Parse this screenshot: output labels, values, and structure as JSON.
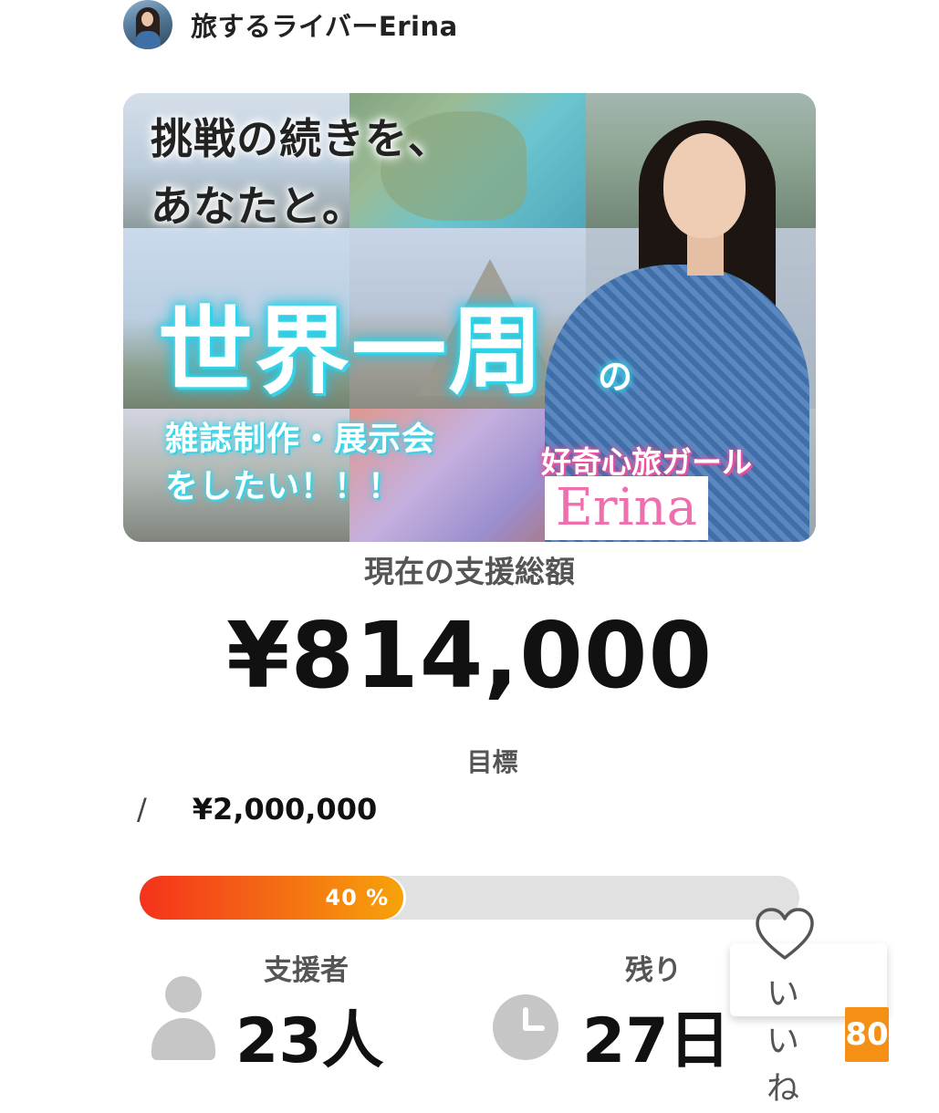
{
  "author": {
    "name": "旅するライバーErina"
  },
  "hero": {
    "line1": "挑戦の続きを、",
    "line2": "あなたと。",
    "big": "世界一周",
    "no": "の",
    "sub1": "雑誌制作・展示会",
    "sub2": "をしたい！！！",
    "tagline": "好奇心旅ガール",
    "name": "Erina"
  },
  "funding": {
    "total_label": "現在の支援総額",
    "total_amount": "¥814,000",
    "goal_label": "目標",
    "goal_slash": "/",
    "goal_amount": "¥2,000,000",
    "progress_percent": 40,
    "progress_label": "40 %"
  },
  "stats": {
    "backers_label": "支援者",
    "backers_value": "23人",
    "remaining_label": "残り",
    "remaining_value": "27日"
  },
  "like": {
    "label": "いいね",
    "count": "80"
  },
  "colors": {
    "progress_start": "#f5321c",
    "progress_end": "#f7a30a",
    "like_badge": "#f49015",
    "neon_cyan": "#29d1ea",
    "pink": "#ef6fae"
  }
}
